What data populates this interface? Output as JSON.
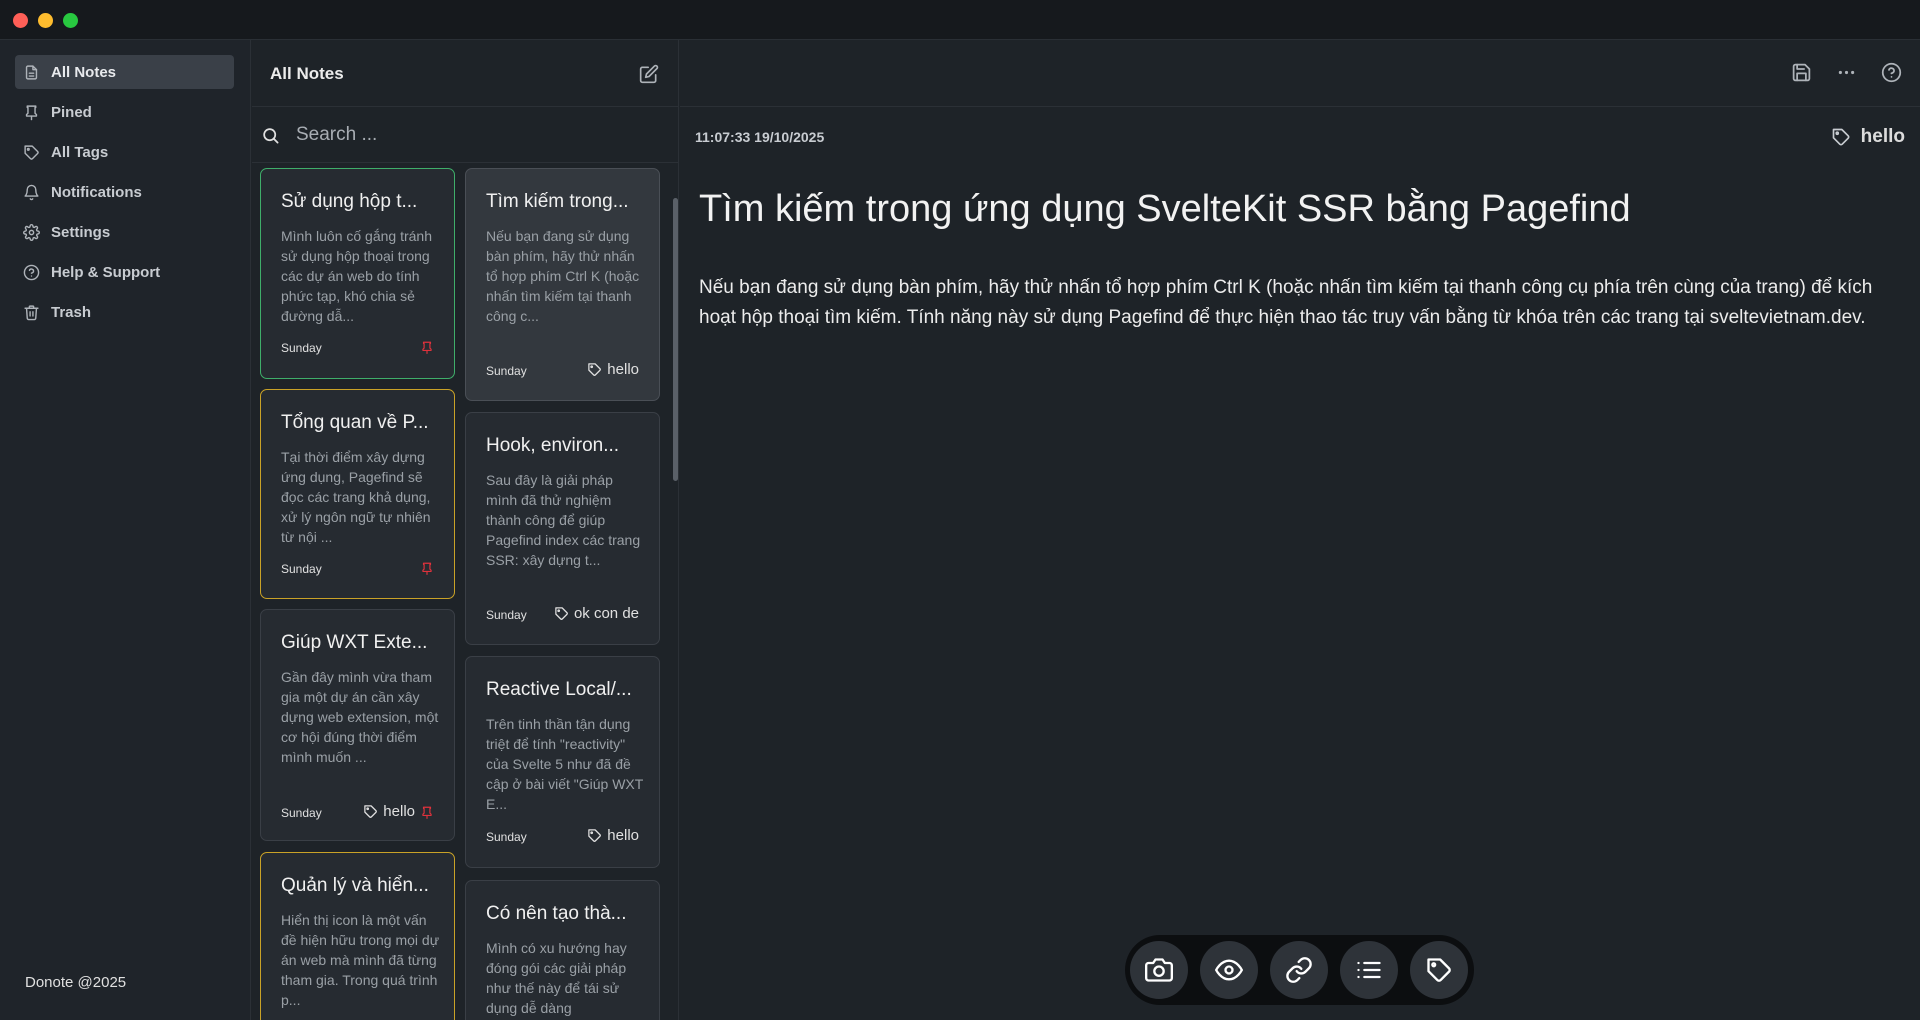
{
  "window": {
    "controls": [
      "close",
      "minimize",
      "maximize"
    ]
  },
  "sidebar": {
    "items": [
      {
        "label": "All Notes",
        "icon": "file-icon",
        "active": true
      },
      {
        "label": "Pined",
        "icon": "pin-icon"
      },
      {
        "label": "All Tags",
        "icon": "tag-icon"
      },
      {
        "label": "Notifications",
        "icon": "bell-icon"
      },
      {
        "label": "Settings",
        "icon": "gear-icon"
      },
      {
        "label": "Help & Support",
        "icon": "help-circle-icon"
      },
      {
        "label": "Trash",
        "icon": "trash-icon"
      }
    ],
    "footer": "Donote @2025"
  },
  "list": {
    "title": "All Notes",
    "search_placeholder": "Search ...",
    "notes": [
      {
        "title": "Sử dụng hộp t...",
        "excerpt": "Mình luôn cố gắng tránh sử dụng hộp thoại trong các dự án web do tính phức tạp, khó chia sẻ đường dẫ...",
        "date": "Sunday",
        "tag": "",
        "pinned": true,
        "border": "green"
      },
      {
        "title": "Tìm kiếm trong...",
        "excerpt": "Nếu bạn đang sử dụng bàn phím, hãy thử nhấn tổ hợp phím Ctrl K (hoặc nhấn tìm kiếm tại thanh công c...",
        "date": "Sunday",
        "tag": "hello",
        "pinned": false,
        "selected": true
      },
      {
        "title": "Tổng quan về P...",
        "excerpt": "Tại thời điểm xây dựng ứng dụng, Pagefind sẽ đọc các trang khả dụng, xử lý ngôn ngữ tự nhiên từ nội ...",
        "date": "Sunday",
        "tag": "",
        "pinned": true,
        "border": "yellow"
      },
      {
        "title": "Hook, environ...",
        "excerpt": "Sau đây là giải pháp mình đã thử nghiệm thành công để giúp Pagefind index các trang SSR: xây dựng t...",
        "date": "Sunday",
        "tag": "ok con de",
        "pinned": false
      },
      {
        "title": "Giúp WXT Exte...",
        "excerpt": "Gần đây mình vừa tham gia một dự án cần xây dựng web extension, một cơ hội đúng thời điểm mình muốn ...",
        "date": "Sunday",
        "tag": "hello",
        "pinned": true
      },
      {
        "title": "Reactive Local/...",
        "excerpt": "Trên tinh thần tận dụng triệt để tính \"reactivity\" của Svelte 5 như đã đề cập ở bài viết \"Giúp WXT E...",
        "date": "Sunday",
        "tag": "hello",
        "pinned": false
      },
      {
        "title": "Quản lý và hiển...",
        "excerpt": "Hiển thị icon là một vấn đề hiện hữu trong mọi dự án web mà mình đã từng tham gia. Trong quá trình p...",
        "date": "",
        "tag": "",
        "pinned": false,
        "border": "yellow"
      },
      {
        "title": "Có nên tạo thà...",
        "excerpt": "Mình có xu hướng hay đóng gói các giải pháp như thế này để tái sử dụng dễ dàng",
        "date": "",
        "tag": "",
        "pinned": false
      }
    ]
  },
  "editor": {
    "timestamp": "11:07:33 19/10/2025",
    "tag": "hello",
    "title": "Tìm kiếm trong ứng dụng SvelteKit SSR bằng Pagefind",
    "body": "Nếu bạn đang sử dụng bàn phím, hãy thử nhấn tổ hợp phím Ctrl K (hoặc nhấn tìm kiếm  tại thanh công cụ phía trên cùng của trang) để kích hoạt hộp thoại tìm kiếm. Tính năng này sử dụng Pagefind để thực hiện thao tác truy vấn bằng từ khóa trên các trang tại sveltevietnam.dev.",
    "top_icons": [
      "save-icon",
      "more-icon",
      "help-icon"
    ],
    "bottom_tools": [
      "camera-icon",
      "eye-icon",
      "link-icon",
      "list-icon",
      "tag-icon"
    ]
  },
  "colors": {
    "accent_green": "#3fae6a",
    "accent_yellow": "#c9a227",
    "pin_red": "#e0323c"
  }
}
